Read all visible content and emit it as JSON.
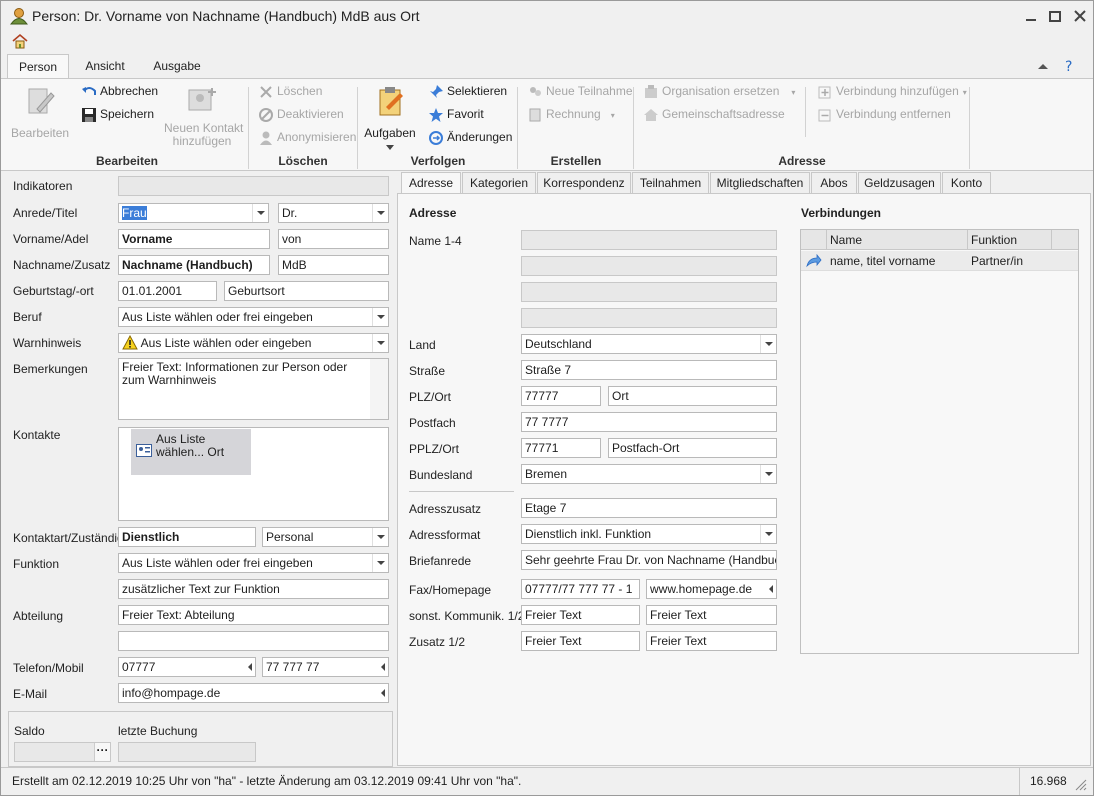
{
  "window": {
    "title": "Person: Dr. Vorname von Nachname (Handbuch) MdB aus Ort"
  },
  "ribbon_tabs": [
    "Person",
    "Ansicht",
    "Ausgabe"
  ],
  "ribbon": {
    "bearbeiten": {
      "group": "Bearbeiten",
      "edit": "Bearbeiten",
      "cancel": "Abbrechen",
      "save": "Speichern",
      "new_contact": "Neuen Kontakt",
      "new_contact2": "hinzufügen"
    },
    "loeschen": {
      "group": "Löschen",
      "delete": "Löschen",
      "deactivate": "Deaktivieren",
      "anonymize": "Anonymisieren"
    },
    "verfolgen": {
      "group": "Verfolgen",
      "tasks": "Aufgaben",
      "select": "Selektieren",
      "favorite": "Favorit",
      "changes": "Änderungen"
    },
    "erstellen": {
      "group": "Erstellen",
      "participation": "Neue Teilnahme",
      "invoice": "Rechnung"
    },
    "adresse": {
      "group": "Adresse",
      "replace_org": "Organisation ersetzen",
      "common_address": "Gemeinschaftsadresse",
      "add_link": "Verbindung hinzufügen",
      "remove_link": "Verbindung entfernen"
    }
  },
  "left": {
    "indicators_label": "Indikatoren",
    "salutation_label": "Anrede/Titel",
    "salutation": "Frau",
    "title": "Dr.",
    "firstname_label": "Vorname/Adel",
    "firstname": "Vorname",
    "nobility": "von",
    "lastname_label": "Nachname/Zusatz",
    "lastname": "Nachname (Handbuch)",
    "suffix": "MdB",
    "birth_label": "Geburtstag/-ort",
    "birthdate": "01.01.2001",
    "birthplace": "Geburtsort",
    "job_label": "Beruf",
    "job": "Aus Liste wählen oder frei eingeben",
    "warning_label": "Warnhinweis",
    "warning": "Aus Liste wählen oder eingeben",
    "remarks_label": "Bemerkungen",
    "remarks": "Freier Text: Informationen zur Person oder zum Warnhinweis",
    "contacts_label": "Kontakte",
    "contact_card": "Aus Liste wählen... Ort",
    "contacttype_label": "Kontaktart/Zuständig",
    "contacttype": "Dienstlich",
    "responsible": "Personal",
    "function_label": "Funktion",
    "function": "Aus Liste wählen oder frei eingeben",
    "function_extra": "zusätzlicher Text zur Funktion",
    "department_label": "Abteilung",
    "department": "Freier Text: Abteilung",
    "department2": "",
    "phone_label": "Telefon/Mobil",
    "phone": "07777",
    "mobile": "77 777 77",
    "email_label": "E-Mail",
    "email": "info@hompage.de",
    "balance_label": "Saldo",
    "lastbooking_label": "letzte Buchung"
  },
  "tabs": [
    "Adresse",
    "Kategorien",
    "Korrespondenz",
    "Teilnahmen",
    "Mitgliedschaften",
    "Abos",
    "Geldzusagen",
    "Konto"
  ],
  "address": {
    "heading": "Adresse",
    "name_label": "Name 1-4",
    "country_label": "Land",
    "country": "Deutschland",
    "street_label": "Straße",
    "street": "Straße 7",
    "zip_label": "PLZ/Ort",
    "zip": "77777",
    "city": "Ort",
    "pobox_label": "Postfach",
    "pobox": "77 7777",
    "pozip_label": "PPLZ/Ort",
    "pozip": "77771",
    "pocity": "Postfach-Ort",
    "state_label": "Bundesland",
    "state": "Bremen",
    "addition_label": "Adresszusatz",
    "addition": "Etage 7",
    "format_label": "Adressformat",
    "format": "Dienstlich inkl. Funktion",
    "letter_label": "Briefanrede",
    "letter": "Sehr geehrte Frau Dr. von Nachname (Handbuch),",
    "fax_label": "Fax/Homepage",
    "fax": "07777/77 777 77 - 1",
    "homepage": "www.homepage.de",
    "comm_label": "sonst. Kommunik. 1/2",
    "comm1": "Freier Text",
    "comm2": "Freier Text",
    "extra_label": "Zusatz 1/2",
    "extra1": "Freier Text",
    "extra2": "Freier Text"
  },
  "links": {
    "heading": "Verbindungen",
    "col_name": "Name",
    "col_function": "Funktion",
    "row_name": "name, titel vorname",
    "row_function": "Partner/in"
  },
  "status": {
    "text": "Erstellt am 02.12.2019 10:25 Uhr von \"ha\" - letzte Änderung am 03.12.2019 09:41 Uhr von \"ha\".",
    "count": "16.968"
  }
}
